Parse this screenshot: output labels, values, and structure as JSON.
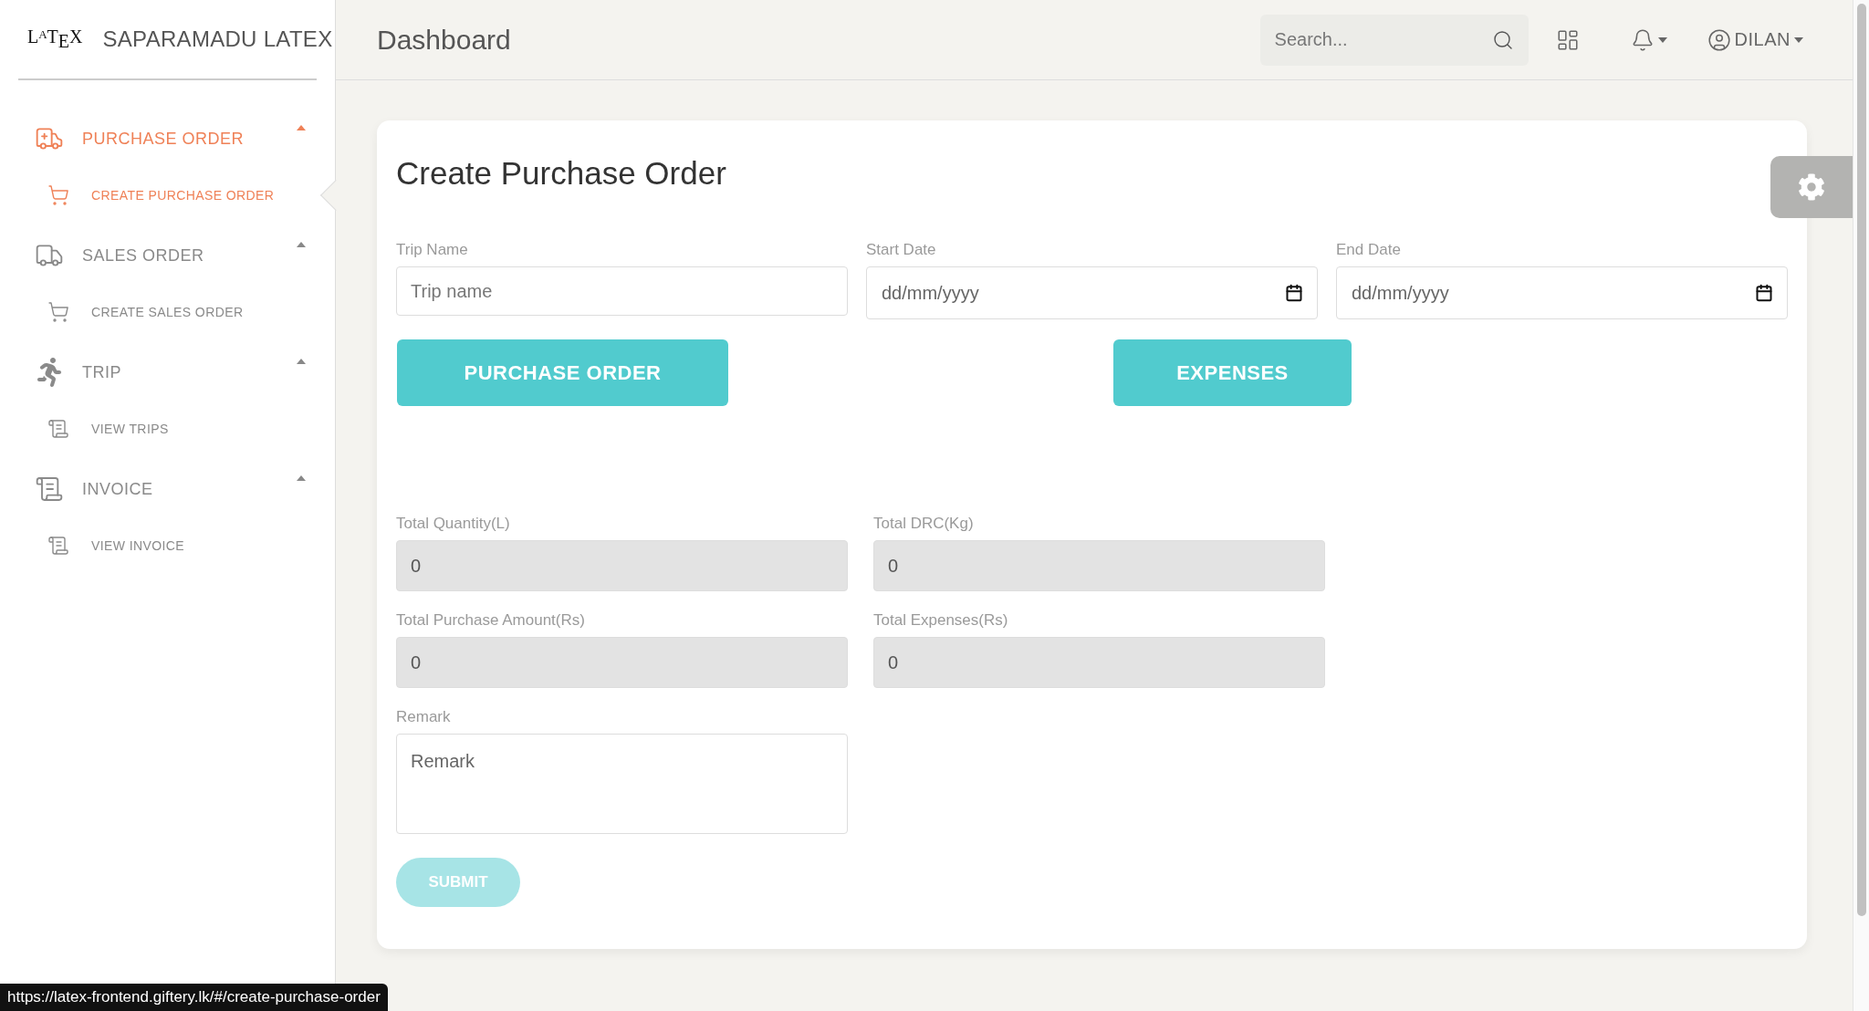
{
  "brand": {
    "logo": "L$^{A}$T$_{E}$X",
    "name": "SAPARAMADU LATEX"
  },
  "header": {
    "title": "Dashboard",
    "search": {
      "placeholder": "Search..."
    },
    "user": "DILAN"
  },
  "sidebar": {
    "groups": [
      {
        "label": "PURCHASE ORDER",
        "selected": true,
        "expanded": true,
        "children": [
          {
            "label": "CREATE PURCHASE ORDER",
            "selected": true
          }
        ]
      },
      {
        "label": "SALES ORDER",
        "selected": false,
        "expanded": true,
        "children": [
          {
            "label": "CREATE SALES ORDER",
            "selected": false
          }
        ]
      },
      {
        "label": "TRIP",
        "selected": false,
        "expanded": true,
        "children": [
          {
            "label": "VIEW TRIPS",
            "selected": false
          }
        ]
      },
      {
        "label": "INVOICE",
        "selected": false,
        "expanded": true,
        "children": [
          {
            "label": "VIEW INVOICE",
            "selected": false
          }
        ]
      }
    ]
  },
  "form": {
    "title": "Create Purchase Order",
    "fields": [
      {
        "label": "Trip Name",
        "placeholder": "Trip name",
        "kind": "text"
      },
      {
        "label": "Start Date",
        "placeholder": "dd/mm/yyyy",
        "kind": "date"
      },
      {
        "label": "End Date",
        "placeholder": "dd/mm/yyyy",
        "kind": "date"
      }
    ],
    "actions": [
      "PURCHASE ORDER",
      "EXPENSES"
    ],
    "totals": [
      {
        "label": "Total Quantity(L)",
        "value": "0",
        "disabled": true
      },
      {
        "label": "Total DRC(Kg)",
        "value": "0",
        "disabled": true
      },
      {
        "label": "Total Purchase Amount(Rs)",
        "value": "0",
        "disabled": true
      },
      {
        "label": "Total Expenses(Rs)",
        "value": "0",
        "disabled": true
      }
    ],
    "remark": {
      "label": "Remark",
      "placeholder": "Remark"
    },
    "submit": {
      "label": "SUBMIT",
      "disabled": true
    }
  },
  "status_bar": "https://latex-frontend.giftery.lk/#/create-purchase-order"
}
